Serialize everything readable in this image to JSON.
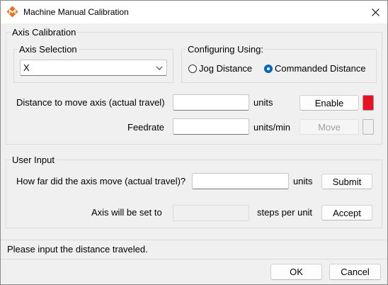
{
  "window": {
    "title": "Machine Manual Calibration",
    "close_glyph": "✕"
  },
  "axis_calibration": {
    "group_label": "Axis Calibration",
    "axis_selection": {
      "group_label": "Axis Selection",
      "selected_value": "X"
    },
    "configuring_using": {
      "group_label": "Configuring Using:",
      "options": [
        "Jog Distance",
        "Commanded Distance"
      ],
      "selected": "Commanded Distance"
    },
    "distance_label": "Distance to move axis (actual travel)",
    "distance_value": "",
    "distance_units": "units",
    "enable_button": "Enable",
    "enable_indicator_color": "#e81123",
    "feedrate_label": "Feedrate",
    "feedrate_value": "",
    "feedrate_units": "units/min",
    "move_button": "Move",
    "move_indicator_color": "#f0f0f0"
  },
  "user_input": {
    "group_label": "User Input",
    "how_far_label": "How far did the axis move (actual travel)?",
    "how_far_value": "",
    "how_far_units": "units",
    "submit_button": "Submit",
    "axis_set_label": "Axis will be set to",
    "axis_set_value": "",
    "steps_label": "steps per unit",
    "accept_button": "Accept"
  },
  "status": {
    "message": "Please input the distance traveled."
  },
  "footer": {
    "ok_button": "OK",
    "cancel_button": "Cancel"
  },
  "colors": {
    "accent": "#0067c0",
    "logo_orange": "#e8731a"
  }
}
